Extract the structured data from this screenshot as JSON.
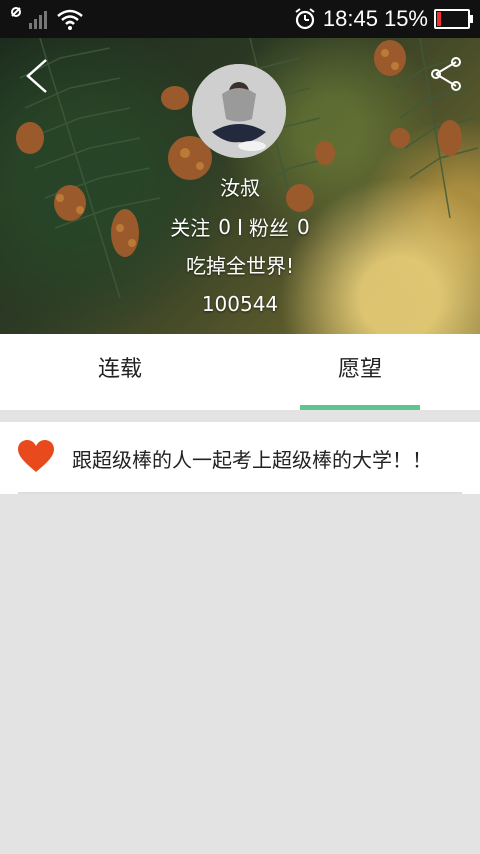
{
  "status_bar": {
    "time": "18:45",
    "battery_percent": "15%",
    "battery_level": 0.15,
    "icons": [
      "no-sim-icon",
      "signal-icon",
      "wifi-icon",
      "alarm-icon",
      "battery-icon"
    ]
  },
  "profile": {
    "name": "汝叔",
    "follow_label": "关注",
    "follow_count": "0",
    "fans_label": "粉丝",
    "fans_count": "0",
    "bio": "吃掉全世界!",
    "user_id": "100544"
  },
  "tabs": [
    {
      "label": "连载",
      "active": false
    },
    {
      "label": "愿望",
      "active": true
    }
  ],
  "wishes": [
    {
      "text": "跟超级棒的人一起考上超级棒的大学！！",
      "icon": "heart-icon"
    }
  ],
  "colors": {
    "accent": "#5cc590",
    "heart": "#e8491d",
    "background": "#e3e3e3"
  }
}
